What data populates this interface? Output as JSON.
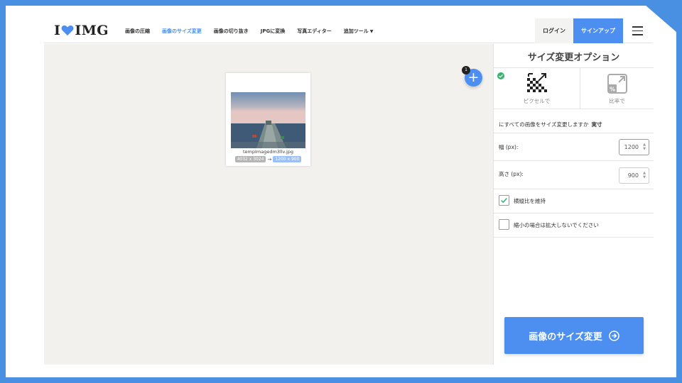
{
  "header": {
    "logo_left": "I",
    "logo_right": "IMG",
    "nav": [
      {
        "label": "画像の圧縮",
        "active": false
      },
      {
        "label": "画像のサイズ変更",
        "active": true
      },
      {
        "label": "画像の切り抜き",
        "active": false
      },
      {
        "label": "JPGに変換",
        "active": false
      },
      {
        "label": "写真エディター",
        "active": false
      },
      {
        "label": "追加ツール",
        "active": false,
        "dropdown": true
      }
    ],
    "login": "ログイン",
    "signup": "サインアップ"
  },
  "workspace": {
    "file": {
      "name": "tempImagedm3llv.jpg",
      "original_size": "4032 x 3024",
      "arrow": "→",
      "new_size": "1200 x 900"
    },
    "file_count": "1",
    "add_symbol": "+"
  },
  "sidebar": {
    "title": "サイズ変更オプション",
    "modes": [
      {
        "label": "ピクセルで",
        "selected": true,
        "icon": "pixel-resize-icon"
      },
      {
        "label": "比率で",
        "selected": false,
        "icon": "percent-resize-icon"
      }
    ],
    "question": "にすべての画像をサイズ変更しますか",
    "question_bold": "実寸",
    "width": {
      "label": "幅 (px):",
      "value": "1200"
    },
    "height": {
      "label": "高さ (px):",
      "value": "900"
    },
    "keep_ratio": {
      "label": "横縦比を維持",
      "checked": true
    },
    "no_enlarge": {
      "label": "縮小の場合は拡大しないでください",
      "checked": false
    },
    "submit": "画像のサイズ変更"
  },
  "colors": {
    "accent": "#4d8ff0",
    "background": "#4a90e2",
    "workspace": "#f3f1ee",
    "check": "#3cb371"
  }
}
